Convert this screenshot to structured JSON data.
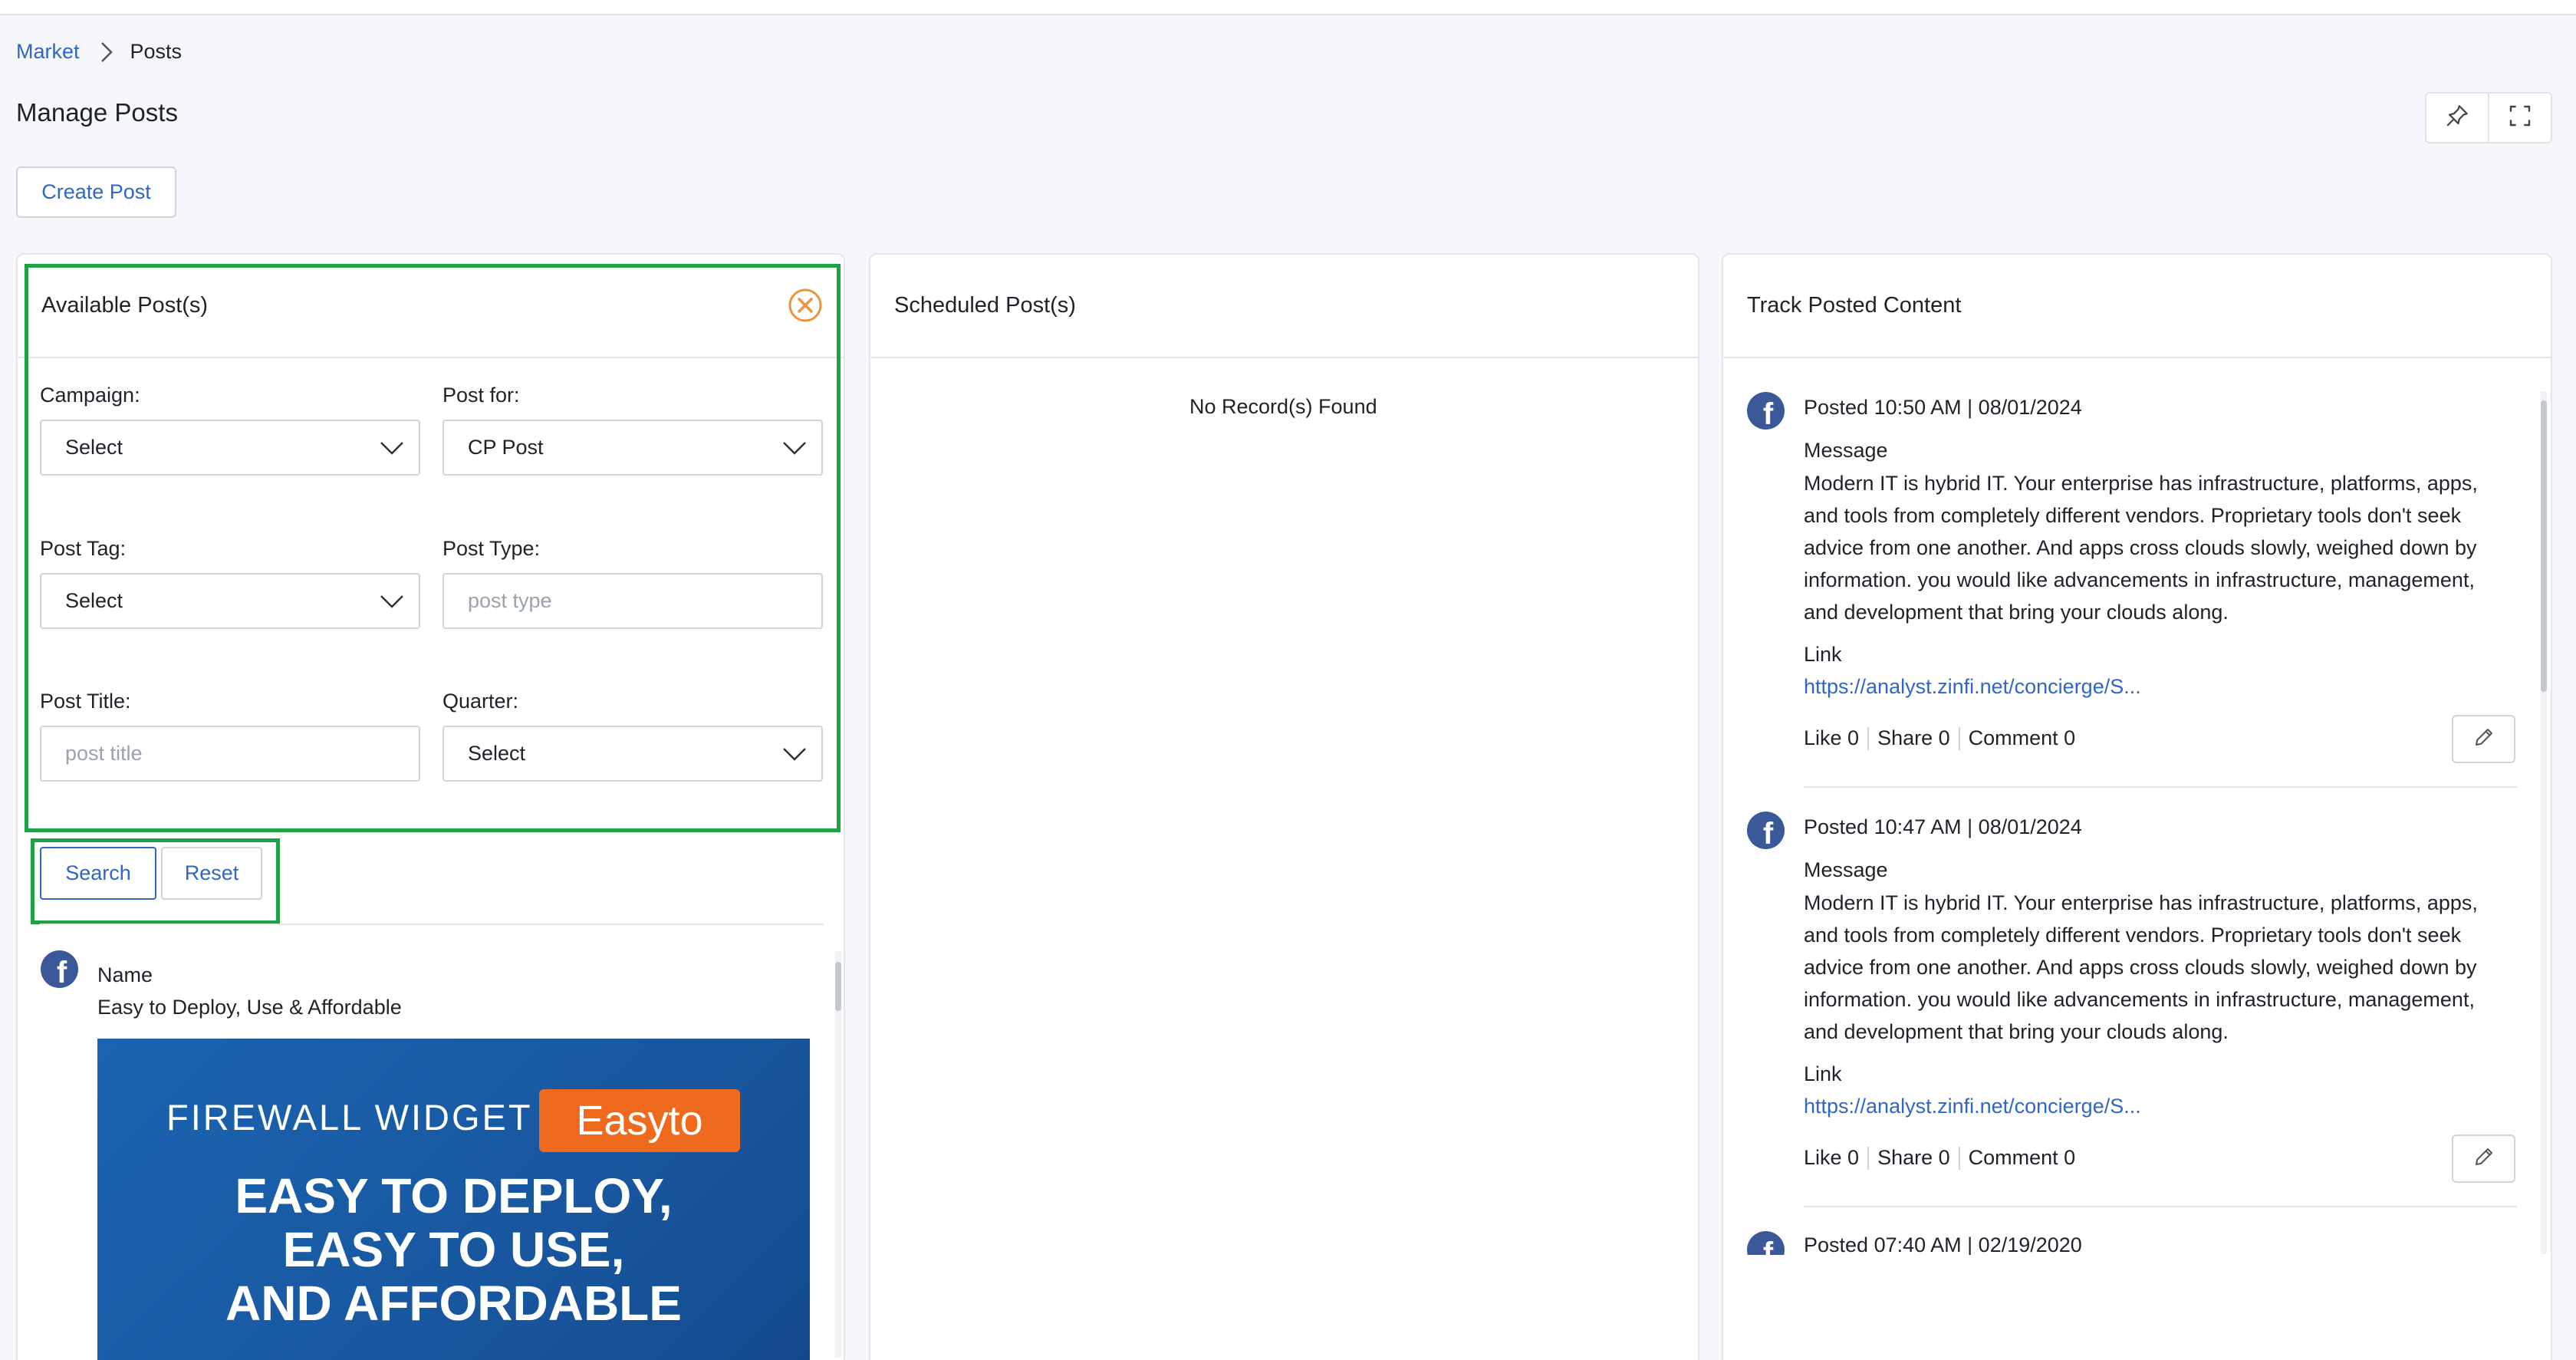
{
  "breadcrumb": {
    "parent": "Market",
    "current": "Posts"
  },
  "page": {
    "title": "Manage Posts",
    "create_label": "Create Post"
  },
  "panels": {
    "available": "Available Post(s)",
    "scheduled": "Scheduled Post(s)",
    "track": "Track Posted Content"
  },
  "filters": {
    "campaign_label": "Campaign:",
    "campaign_value": "Select",
    "post_for_label": "Post for:",
    "post_for_value": "CP Post",
    "post_tag_label": "Post Tag:",
    "post_tag_value": "Select",
    "post_type_label": "Post Type:",
    "post_type_placeholder": "post type",
    "post_title_label": "Post Title:",
    "post_title_placeholder": "post title",
    "quarter_label": "Quarter:",
    "quarter_value": "Select"
  },
  "actions": {
    "search": "Search",
    "reset": "Reset"
  },
  "available_post": {
    "name_label": "Name",
    "name_value": "Easy to Deploy, Use & Affordable",
    "banner_head": "FIREWALL WIDGET",
    "banner_badge": "Easyto",
    "banner_line1": "EASY TO DEPLOY,",
    "banner_line2": "EASY TO USE,",
    "banner_line3": "AND AFFORDABLE"
  },
  "scheduled": {
    "empty": "No Record(s) Found"
  },
  "track_items": [
    {
      "posted_label": "Posted",
      "posted_value": "10:50 AM | 08/01/2024",
      "message_label": "Message",
      "message": "Modern IT is hybrid IT. Your enterprise has infrastructure, platforms, apps, and tools from completely different vendors. Proprietary tools don't seek advice from one another. And apps cross clouds slowly, weighed down by information. you would like advancements in infrastructure, management, and development that bring your clouds along.",
      "link_label": "Link",
      "link": "https://analyst.zinfi.net/concierge/S...",
      "like": "Like 0",
      "share": "Share 0",
      "comment": "Comment 0"
    },
    {
      "posted_label": "Posted",
      "posted_value": "10:47 AM | 08/01/2024",
      "message_label": "Message",
      "message": "Modern IT is hybrid IT. Your enterprise has infrastructure, platforms, apps, and tools from completely different vendors. Proprietary tools don't seek advice from one another. And apps cross clouds slowly, weighed down by information. you would like advancements in infrastructure, management, and development that bring your clouds along.",
      "link_label": "Link",
      "link": "https://analyst.zinfi.net/concierge/S...",
      "like": "Like 0",
      "share": "Share 0",
      "comment": "Comment 0"
    },
    {
      "posted_label": "Posted",
      "posted_value": "07:40 AM | 02/19/2020"
    }
  ],
  "icons": {
    "facebook": "facebook-icon",
    "pin": "pin-icon",
    "fullscreen": "fullscreen-icon",
    "close": "close-circle-icon",
    "edit": "pencil-icon",
    "chevron": "chevron-down-icon"
  },
  "colors": {
    "accent": "#2f66c8",
    "highlight": "#1fa045",
    "close": "#e8963e",
    "facebook": "#3b5898"
  }
}
